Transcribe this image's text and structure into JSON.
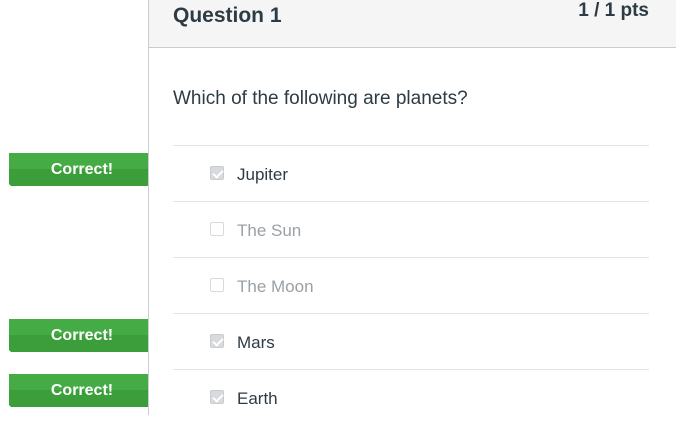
{
  "question": {
    "title": "Question 1",
    "points": "1 / 1 pts",
    "text": "Which of the following are planets?"
  },
  "answers": [
    {
      "label": "Jupiter",
      "checked": true
    },
    {
      "label": "The Sun",
      "checked": false
    },
    {
      "label": "The Moon",
      "checked": false
    },
    {
      "label": "Mars",
      "checked": true
    },
    {
      "label": "Earth",
      "checked": true
    }
  ],
  "flags": {
    "label": "Correct!",
    "color": "#3ca03c"
  }
}
